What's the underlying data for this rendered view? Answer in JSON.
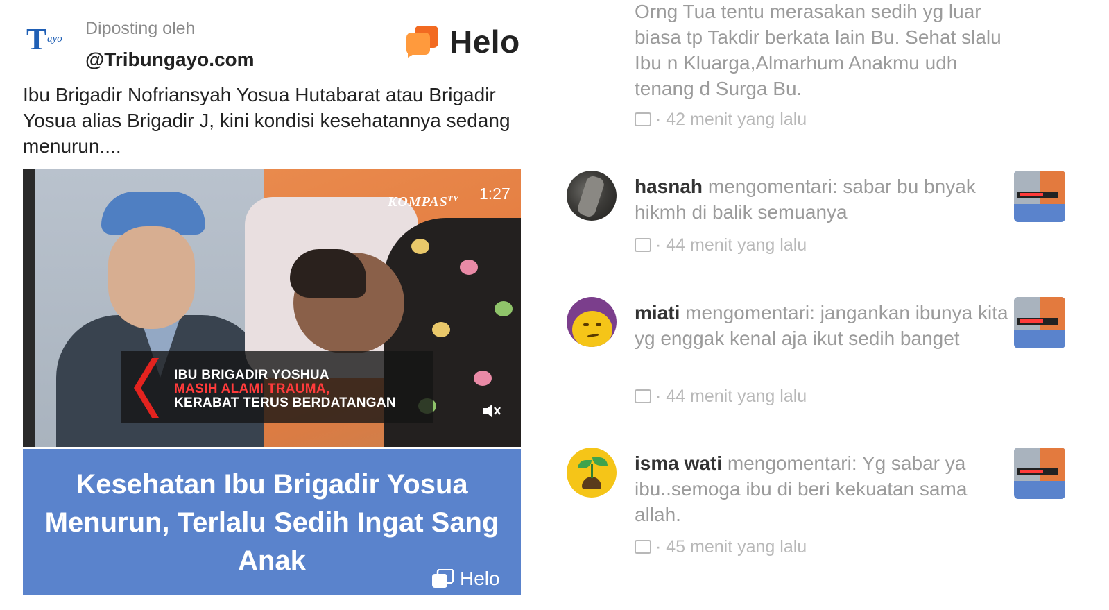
{
  "post": {
    "posted_by_label": "Diposting oleh",
    "source_name": "@Tribungayo.com",
    "source_logo": {
      "main": "T",
      "sub": "ayo"
    },
    "brand": "Helo",
    "excerpt": "Ibu Brigadir Nofriansyah Yosua Hutabarat atau Brigadir Yosua alias Brigadir J, kini kondisi kesehatannya sedang menurun....",
    "media": {
      "channel": "KOMPAS",
      "channel_suffix": "TV",
      "duration": "1:27",
      "caption_lines": [
        "IBU BRIGADIR YOSHUA",
        "MASIH ALAMI TRAUMA,",
        "KERABAT TERUS BERDATANGAN"
      ]
    },
    "headline": "Kesehatan Ibu Brigadir Yosua Menurun, Terlalu Sedih Ingat Sang Anak",
    "banner_brand": "Helo",
    "colors": {
      "banner": "#5a83cc",
      "brand_orange": "#f26a21",
      "caption_red": "#ff3b3b"
    }
  },
  "comments": [
    {
      "username": "",
      "verb": "",
      "text": "Orng Tua tentu merasakan sedih yg luar biasa tp Takdir berkata lain Bu. Sehat slalu Ibu n Kluarga,Almarhum Anakmu udh tenang d Surga Bu.",
      "time": "42 menit yang lalu"
    },
    {
      "username": "hasnah",
      "verb": "mengomentari:",
      "text": "sabar bu bnyak hikmh di balik semuanya",
      "time": "44 menit yang lalu",
      "avatar_icon": "rock-photo-avatar"
    },
    {
      "username": "miati",
      "verb": "mengomentari:",
      "text": "jangankan ibunya kita yg enggak kenal aja ikut sedih banget",
      "time": "44 menit yang lalu",
      "avatar_icon": "emoji-face-avatar"
    },
    {
      "username": "isma wati",
      "verb": "mengomentari:",
      "text": "Yg sabar ya ibu..semoga ibu di beri kekuatan sama allah.",
      "time": "45 menit yang lalu",
      "avatar_icon": "sprout-avatar"
    }
  ],
  "meta_separator": "·"
}
